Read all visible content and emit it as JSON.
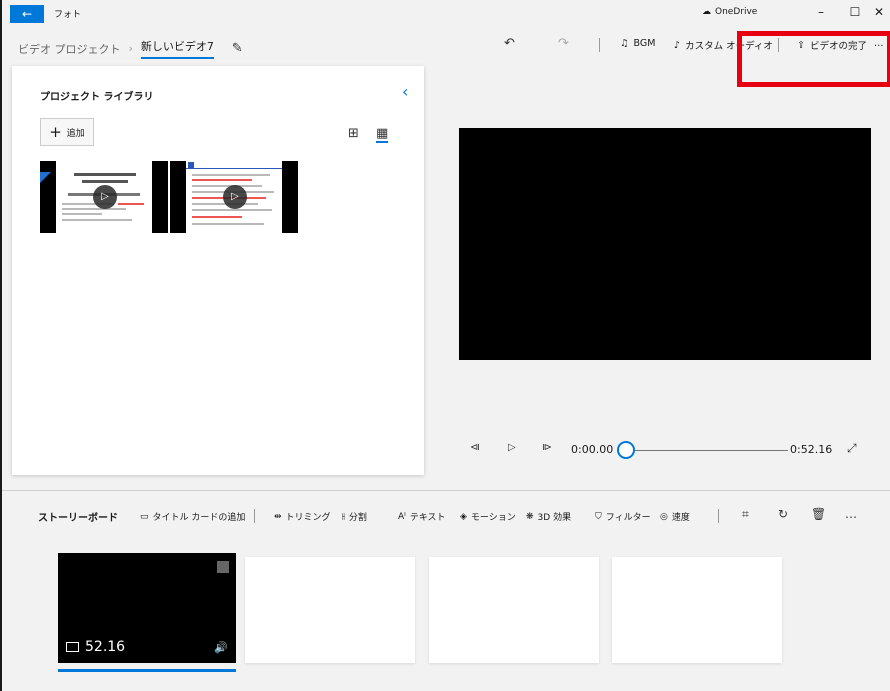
{
  "titlebar": {
    "back_label": "←",
    "app_title": "フォト",
    "onedrive_label": "OneDrive",
    "minimize": "–",
    "maximize": "☐",
    "close": "✕"
  },
  "toolbar": {
    "breadcrumb_root": "ビデオ プロジェクト",
    "breadcrumb_sep": "›",
    "project_name": "新しいビデオ7",
    "edit_icon": "✎",
    "undo_icon": "↶",
    "redo_icon": "↷",
    "bgm_label": "BGM",
    "custom_audio_label": "カスタム オーディオ",
    "finish_label": "ビデオの完了",
    "more_label": "…"
  },
  "library": {
    "title": "プロジェクト ライブラリ",
    "collapse_icon": "‹",
    "add_label": "追加",
    "add_icon": "+",
    "view_large": "⊞",
    "view_small": "▦"
  },
  "player": {
    "current_time": "0:00.00",
    "total_time": "0:52.16",
    "progress": 0,
    "prev_icon": "⧏",
    "play_icon": "▷",
    "next_icon": "⧐",
    "fullscreen_icon": "⤢"
  },
  "storyboard": {
    "title": "ストーリーボード",
    "tools": {
      "title_card": "タイトル カードの追加",
      "trim": "トリミング",
      "split": "分割",
      "text": "テキスト",
      "motion": "モーション",
      "effects_3d": "3D 効果",
      "filter": "フィルター",
      "speed": "速度"
    },
    "clip_duration": "52.16",
    "more_label": "…"
  },
  "colors": {
    "accent": "#0078d7",
    "highlight": "#e60012"
  }
}
